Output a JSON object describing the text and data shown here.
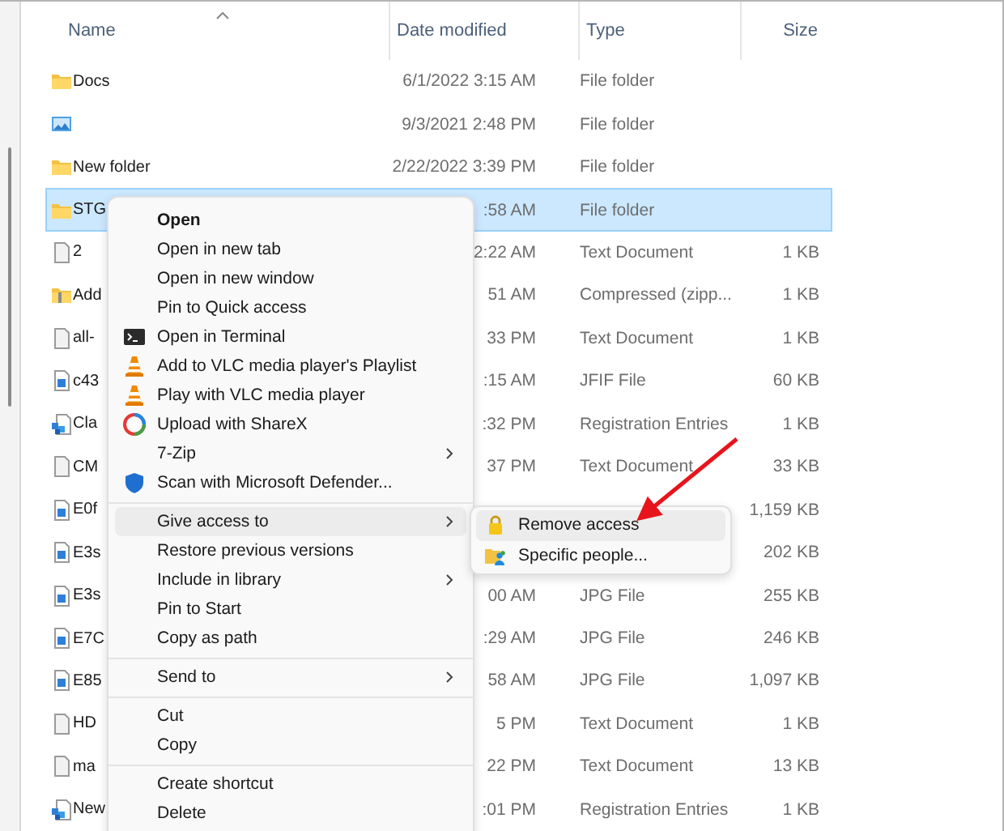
{
  "columns": [
    "Name",
    "Date modified",
    "Type",
    "Size"
  ],
  "rows": [
    {
      "kind": "folder",
      "name": "Docs",
      "date": "6/1/2022 3:15 AM",
      "type": "File folder",
      "selected": false
    },
    {
      "kind": "picture-folder",
      "date": "9/3/2021 2:48 PM",
      "type": "File folder",
      "selected": false
    },
    {
      "kind": "folder",
      "name": "New folder",
      "date": "2/22/2022 3:39 PM",
      "type": "File folder",
      "selected": false
    },
    {
      "kind": "folder",
      "name": "STG",
      "date": ":58 AM",
      "type": "File folder",
      "selected": true
    },
    {
      "kind": "text",
      "name": "2",
      "date": "2:22 AM",
      "type": "Text Document",
      "size": "1 KB",
      "selected": false
    },
    {
      "kind": "zip",
      "name": "Add",
      "date": "51 AM",
      "type": "Compressed (zipp...",
      "size": "1 KB",
      "selected": false
    },
    {
      "kind": "text",
      "name": "all-",
      "date": "33 PM",
      "type": "Text Document",
      "size": "1 KB",
      "selected": false
    },
    {
      "kind": "image",
      "name": "c43",
      "date": ":15 AM",
      "type": "JFIF File",
      "size": "60 KB",
      "selected": false
    },
    {
      "kind": "reg",
      "name": "Cla",
      "date": ":32 PM",
      "type": "Registration Entries",
      "size": "1 KB",
      "selected": false
    },
    {
      "kind": "text",
      "name": "CM",
      "date": "37 PM",
      "type": "Text Document",
      "size": "33 KB",
      "selected": false
    },
    {
      "kind": "image",
      "name": "E0f",
      "size": "1,159 KB",
      "selected": false
    },
    {
      "kind": "image",
      "name": "E3s",
      "size": "202 KB",
      "selected": false
    },
    {
      "kind": "image",
      "name": "E3s",
      "date": "00 AM",
      "type": "JPG File",
      "size": "255 KB",
      "selected": false
    },
    {
      "kind": "image",
      "name": "E7C",
      "date": ":29 AM",
      "type": "JPG File",
      "size": "246 KB",
      "selected": false
    },
    {
      "kind": "image",
      "name": "E85",
      "date": "58 AM",
      "type": "JPG File",
      "size": "1,097 KB",
      "selected": false
    },
    {
      "kind": "text",
      "name": "HD",
      "date": "5 PM",
      "type": "Text Document",
      "size": "1 KB",
      "selected": false
    },
    {
      "kind": "text",
      "name": "ma",
      "date": "22 PM",
      "type": "Text Document",
      "size": "13 KB",
      "selected": false
    },
    {
      "kind": "reg",
      "name": "New",
      "date": ":01 PM",
      "type": "Registration Entries",
      "size": "1 KB",
      "selected": false
    }
  ],
  "context_menu": {
    "groups": [
      [
        {
          "label": "Open",
          "default": true,
          "selected": false
        },
        {
          "label": "Open in new tab",
          "selected": false
        },
        {
          "label": "Open in new window",
          "selected": false
        },
        {
          "label": "Pin to Quick access",
          "selected": false
        },
        {
          "label": "Open in Terminal",
          "kind": "terminal",
          "selected": false
        },
        {
          "label": "Add to VLC media player's Playlist",
          "kind": "cone",
          "selected": false
        },
        {
          "label": "Play with VLC media player",
          "kind": "cone",
          "selected": false
        },
        {
          "label": "Upload with ShareX",
          "kind": "ring",
          "selected": false
        },
        {
          "label": "7-Zip",
          "submenu": true,
          "selected": false
        },
        {
          "label": "Scan with Microsoft Defender...",
          "kind": "shield",
          "selected": false
        }
      ],
      [
        {
          "label": "Give access to",
          "submenu": true,
          "selected": true
        },
        {
          "label": "Restore previous versions",
          "selected": false
        },
        {
          "label": "Include in library",
          "submenu": true,
          "selected": false
        },
        {
          "label": "Pin to Start",
          "selected": false
        },
        {
          "label": "Copy as path",
          "selected": false
        }
      ],
      [
        {
          "label": "Send to",
          "submenu": true,
          "selected": false
        }
      ],
      [
        {
          "label": "Cut",
          "selected": false
        },
        {
          "label": "Copy",
          "selected": false
        }
      ],
      [
        {
          "label": "Create shortcut",
          "selected": false
        },
        {
          "label": "Delete",
          "selected": false
        }
      ]
    ]
  },
  "submenu": [
    {
      "label": "Remove access",
      "kind": "lock",
      "selected": true
    },
    {
      "label": "Specific people...",
      "kind": "people",
      "selected": false
    }
  ]
}
